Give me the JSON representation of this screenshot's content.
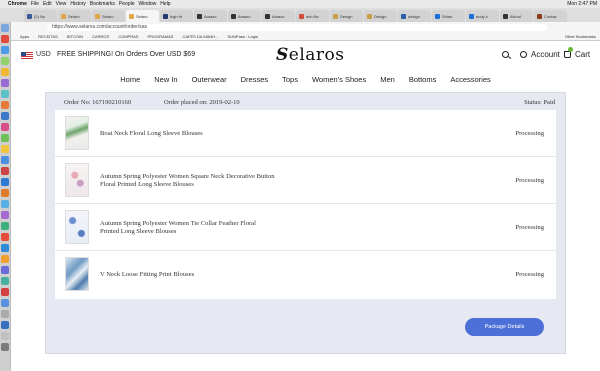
{
  "os_menubar": {
    "apple_glyph": "",
    "items": [
      "Chrome",
      "File",
      "Edit",
      "View",
      "History",
      "Bookmarks",
      "People",
      "Window",
      "Help"
    ],
    "clock": "Mon 2:47 PM"
  },
  "browser": {
    "tabs": [
      {
        "label": "(2) No",
        "color": "#3b5998"
      },
      {
        "label": "Selaro",
        "color": "#e0a64a"
      },
      {
        "label": "Selaro",
        "color": "#e0a64a"
      },
      {
        "label": "Selaro",
        "color": "#e0a64a"
      },
      {
        "label": "high fn",
        "color": "#20376e"
      },
      {
        "label": "Amazo",
        "color": "#333333"
      },
      {
        "label": "Amazo",
        "color": "#333333"
      },
      {
        "label": "Amazo",
        "color": "#333333"
      },
      {
        "label": "ach Ne",
        "color": "#d24b3a"
      },
      {
        "label": "Design",
        "color": "#c7a04a"
      },
      {
        "label": "Design",
        "color": "#c7a04a"
      },
      {
        "label": "design",
        "color": "#2a5fa8"
      },
      {
        "label": "Shirts",
        "color": "#1c6fd6"
      },
      {
        "label": "body c",
        "color": "#1c6fd6"
      },
      {
        "label": "Alchol",
        "color": "#333333"
      },
      {
        "label": "Contac",
        "color": "#8a3b1c"
      }
    ],
    "active_tab_index": 3,
    "url": "https://www.selaros.com/account/order/sas",
    "bookmarks": [
      "Apps",
      "RECEITAS",
      "BITCOIN",
      "CARROS",
      "COMPRAS",
      "PROGRAMAS",
      "CAFÉS DA MANH...",
      "SUNPass : Login"
    ],
    "other_bookmarks": "Other Bookmarks"
  },
  "site": {
    "currency": "USD",
    "shipping_banner": "FREE SHIPPING! On Orders Over USD $69",
    "logo_prefix": "S",
    "logo_rest": "elaros",
    "account_label": "Account",
    "cart_label": "Cart",
    "nav": [
      "Home",
      "New In",
      "Outerwear",
      "Dresses",
      "Tops",
      "Women's Shoes",
      "Men",
      "Bottoms",
      "Accessories"
    ]
  },
  "order": {
    "number_label": "Order No:",
    "number": "167190210160",
    "date_label": "Order placed on:",
    "date": "2019-02-10",
    "status_label": "Status:",
    "status": "Paid",
    "items": [
      {
        "title": "Boat Neck Floral Long Sleeve Blouses",
        "status": "Processing"
      },
      {
        "title": "Autumn Spring Polyester Women Square Neck Decorative Button Floral Printed Long Sleeve Blouses",
        "status": "Processing"
      },
      {
        "title": "Autumn Spring Polyester Women Tie Collar Feather Floral Printed Long Sleeve Blouses",
        "status": "Processing"
      },
      {
        "title": "V Neck Loose Fitting Print Blouses",
        "status": "Processing"
      }
    ],
    "package_button": "Package Details"
  }
}
